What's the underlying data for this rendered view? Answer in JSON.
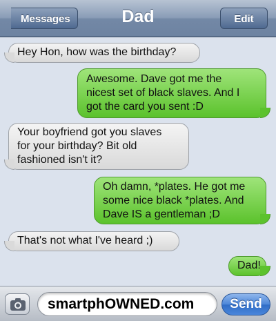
{
  "header": {
    "back_label": "Messages",
    "title": "Dad",
    "edit_label": "Edit"
  },
  "messages": [
    {
      "direction": "in",
      "text": "Hey Hon, how was the birthday?"
    },
    {
      "direction": "out",
      "text": "Awesome. Dave got me the\nnicest set of black slaves. And I\ngot the card you sent :D"
    },
    {
      "direction": "in",
      "text": "Your boyfriend got you slaves\nfor your birthday? Bit old\nfashioned isn't it?"
    },
    {
      "direction": "out",
      "text": "Oh damn, *plates. He got me\nsome nice black *plates. And\nDave IS a gentleman ;D"
    },
    {
      "direction": "in",
      "text": "That's not what I've heard ;)"
    },
    {
      "direction": "out",
      "text": "Dad!"
    }
  ],
  "composer": {
    "input_value": "smartphOWNED.com",
    "send_label": "Send",
    "camera_icon": "camera-icon"
  },
  "colors": {
    "outgoing_bubble": "#6cc93a",
    "incoming_bubble": "#e6e6e6",
    "background": "#dbe2ed",
    "send_button": "#3d79d1"
  }
}
